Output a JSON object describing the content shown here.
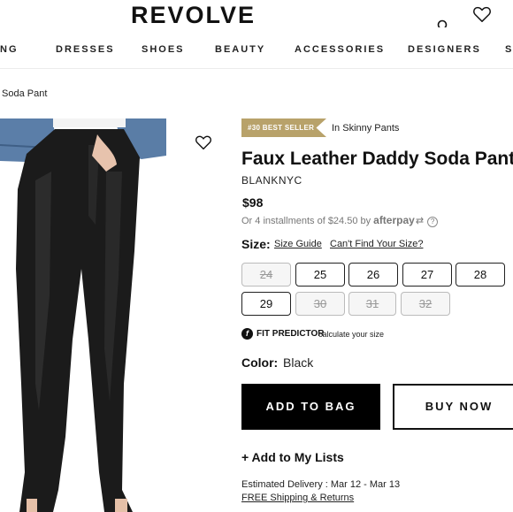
{
  "header": {
    "logo": "REVOLVE",
    "icons": [
      "search-icon",
      "heart-icon"
    ]
  },
  "nav": {
    "items": [
      "NG",
      "DRESSES",
      "SHOES",
      "BEAUTY",
      "ACCESSORIES",
      "DESIGNERS",
      "S"
    ]
  },
  "breadcrumb": "Soda Pant",
  "badge": {
    "label": "#30 BEST SELLER",
    "category": "In Skinny Pants",
    "color": "#b8a26a"
  },
  "product": {
    "title": "Faux Leather Daddy Soda Pant",
    "brand": "BLANKNYC",
    "price": "$98",
    "installments": "Or 4 installments of $24.50 by",
    "afterpay": "afterpay",
    "help": "?"
  },
  "size": {
    "label": "Size:",
    "guide": "Size Guide",
    "cant_find": "Can't Find Your Size?",
    "options": [
      {
        "value": "24",
        "available": false
      },
      {
        "value": "25",
        "available": true
      },
      {
        "value": "26",
        "available": true
      },
      {
        "value": "27",
        "available": true
      },
      {
        "value": "28",
        "available": true
      },
      {
        "value": "29",
        "available": true
      },
      {
        "value": "30",
        "available": false
      },
      {
        "value": "31",
        "available": false
      },
      {
        "value": "32",
        "available": false
      }
    ]
  },
  "fit": {
    "icon": "f",
    "label": "FIT PREDICTOR",
    "sub": "calculate your size"
  },
  "color": {
    "label": "Color:",
    "value": "Black"
  },
  "actions": {
    "add_to_bag": "ADD TO BAG",
    "buy_now": "BUY NOW",
    "add_lists": "+ Add to My Lists"
  },
  "shipping": {
    "delivery": "Estimated Delivery : Mar 12 - Mar 13",
    "free": "FREE Shipping & Returns"
  }
}
